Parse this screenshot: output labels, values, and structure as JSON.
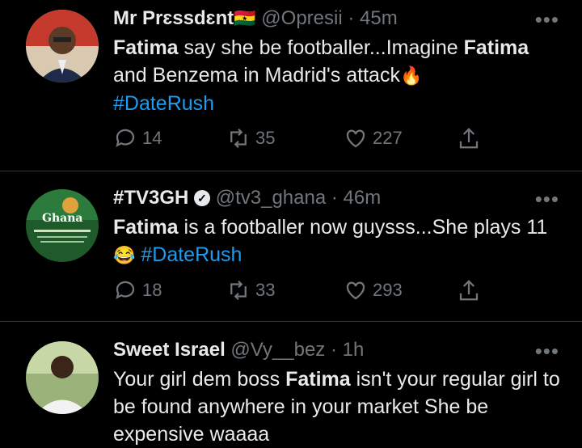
{
  "tweets": [
    {
      "name": "Mr Prɛssdɛnt",
      "flag": "🇬🇭",
      "handle": "@Opresii",
      "sep": "·",
      "time": "45m",
      "more": "•••",
      "body": [
        {
          "b": "Fatima"
        },
        {
          "t": " say she be footballer...Imagine "
        },
        {
          "b": "Fatima"
        },
        {
          "t": " and Benzema in Madrid's attack"
        },
        {
          "e": "🔥"
        },
        {
          "br": ""
        },
        {
          "h": "#DateRush"
        }
      ],
      "replies": "14",
      "retweets": "35",
      "likes": "227"
    },
    {
      "name": "#TV3GH",
      "verified": "✓",
      "handle": "@tv3_ghana",
      "sep": "·",
      "time": "46m",
      "more": "•••",
      "avatar_text": "Ghana",
      "body": [
        {
          "b": "Fatima"
        },
        {
          "t": " is a footballer now guysss...She plays 11"
        },
        {
          "e": "😂"
        },
        {
          "t": " "
        },
        {
          "h": "#DateRush"
        }
      ],
      "replies": "18",
      "retweets": "33",
      "likes": "293"
    },
    {
      "name": "Sweet Israel",
      "handle": "@Vy__bez",
      "sep": "·",
      "time": "1h",
      "more": "•••",
      "body": [
        {
          "t": "Your girl dem boss "
        },
        {
          "b": "Fatima"
        },
        {
          "t": " isn't your regular girl to be found anywhere in your market She be expensive waaaa"
        }
      ]
    }
  ],
  "colors": {
    "background": "#000000",
    "text": "#e7e9ea",
    "muted": "#71767b",
    "link": "#1d9bf0",
    "divider": "#2f3336"
  },
  "icons": [
    "reply-icon",
    "retweet-icon",
    "like-icon",
    "share-icon",
    "more-icon",
    "verified-badge-icon"
  ]
}
